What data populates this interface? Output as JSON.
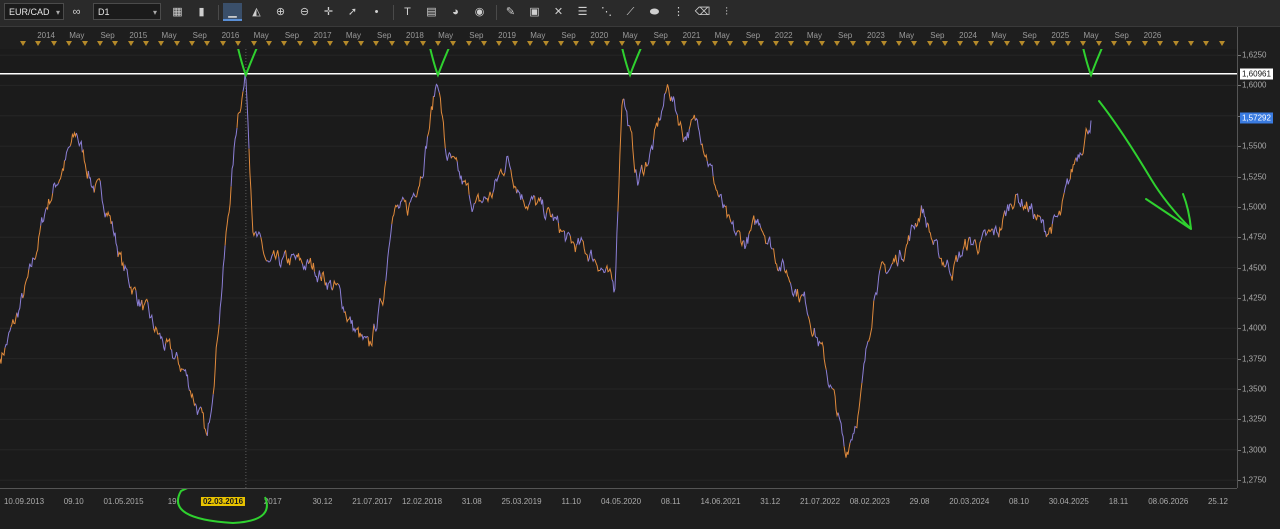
{
  "toolbar": {
    "symbol": "EUR/CAD",
    "timeframe": "D1",
    "buttons": [
      {
        "name": "chart-type-icon",
        "glyph": "▦"
      },
      {
        "name": "candle-icon",
        "glyph": "▮"
      },
      {
        "name": "line-chart-icon",
        "glyph": "▁",
        "active": true
      },
      {
        "name": "area-chart-icon",
        "glyph": "◭"
      },
      {
        "name": "zoom-in-icon",
        "glyph": "⊕"
      },
      {
        "name": "zoom-out-icon",
        "glyph": "⊖"
      },
      {
        "name": "crosshair-icon",
        "glyph": "✛"
      },
      {
        "name": "cursor-icon",
        "glyph": "➚"
      },
      {
        "name": "dot-icon",
        "glyph": "•"
      },
      {
        "name": "text-tool-icon",
        "glyph": "T"
      },
      {
        "name": "note-icon",
        "glyph": "▤"
      },
      {
        "name": "object-icon",
        "glyph": "◕"
      },
      {
        "name": "globe-icon",
        "glyph": "◉"
      },
      {
        "name": "pencil-icon",
        "glyph": "✎"
      },
      {
        "name": "template-icon",
        "glyph": "▣"
      },
      {
        "name": "pattern-icon",
        "glyph": "✕"
      },
      {
        "name": "channel-icon",
        "glyph": "☰"
      },
      {
        "name": "fibonacci-icon",
        "glyph": "⋱"
      },
      {
        "name": "trendline-icon",
        "glyph": "⟋"
      },
      {
        "name": "ellipse-icon",
        "glyph": "⬬"
      },
      {
        "name": "grid-icon",
        "glyph": "⋮"
      },
      {
        "name": "eraser-icon",
        "glyph": "⌫"
      },
      {
        "name": "indicators-icon",
        "glyph": "⫶"
      }
    ]
  },
  "chart_data": {
    "type": "line",
    "title": "",
    "xlabel": "",
    "ylabel": "",
    "ylim": [
      1.2685,
      1.63
    ],
    "x_range": [
      "2013-07",
      "2026-12"
    ],
    "y_ticks": [
      "1,6250",
      "1,6000",
      "1,5750",
      "1,5500",
      "1,5250",
      "1,5000",
      "1,4750",
      "1,4500",
      "1,4250",
      "1,4000",
      "1,3750",
      "1,3500",
      "1,3250",
      "1,3000",
      "1,2750"
    ],
    "price_labels": [
      {
        "value": "1,60961",
        "kind": "horizontal-line"
      },
      {
        "value": "1,57292",
        "kind": "current-price"
      }
    ],
    "top_labels": [
      "2014",
      "May",
      "Sep",
      "2015",
      "May",
      "Sep",
      "2016",
      "May",
      "Sep",
      "2017",
      "May",
      "Sep",
      "2018",
      "May",
      "Sep",
      "2019",
      "May",
      "Sep",
      "2020",
      "May",
      "Sep",
      "2021",
      "May",
      "Sep",
      "2022",
      "May",
      "Sep",
      "2023",
      "May",
      "Sep",
      "2024",
      "May",
      "Sep",
      "2025",
      "May",
      "Sep",
      "2026"
    ],
    "bottom_labels": [
      "10.09.2013",
      "09.10",
      "01.05.2015",
      "19.",
      "02.03.2016",
      "2017",
      "30.12",
      "21.07.2017",
      "12.02.2018",
      "31.08",
      "25.03.2019",
      "11.10",
      "04.05.2020",
      "08.11",
      "14.06.2021",
      "31.12",
      "21.07.2022",
      "08.02.2023",
      "29.08",
      "20.03.2024",
      "08.10",
      "30.04.2025",
      "18.11",
      "08.06.2026",
      "25.12"
    ],
    "highlighted_date": "02.03.2016",
    "series": [
      {
        "points": [
          [
            "2013-07",
            1.375
          ],
          [
            "2013-09",
            1.405
          ],
          [
            "2013-11",
            1.445
          ],
          [
            "2014-01",
            1.5
          ],
          [
            "2014-03",
            1.53
          ],
          [
            "2014-05",
            1.56
          ],
          [
            "2014-07",
            1.52
          ],
          [
            "2014-09",
            1.5
          ],
          [
            "2014-11",
            1.45
          ],
          [
            "2015-01",
            1.425
          ],
          [
            "2015-03",
            1.4
          ],
          [
            "2015-05",
            1.38
          ],
          [
            "2015-07",
            1.365
          ],
          [
            "2015-09",
            1.33
          ],
          [
            "2015-10",
            1.305
          ],
          [
            "2015-12",
            1.445
          ],
          [
            "2016-02",
            1.58
          ],
          [
            "2016-03",
            1.608
          ],
          [
            "2016-04",
            1.48
          ],
          [
            "2016-06",
            1.45
          ],
          [
            "2016-09",
            1.455
          ],
          [
            "2016-12",
            1.45
          ],
          [
            "2017-03",
            1.43
          ],
          [
            "2017-05",
            1.4
          ],
          [
            "2017-07",
            1.38
          ],
          [
            "2017-09",
            1.43
          ],
          [
            "2017-10",
            1.5
          ],
          [
            "2017-12",
            1.495
          ],
          [
            "2018-02",
            1.535
          ],
          [
            "2018-04",
            1.608
          ],
          [
            "2018-05",
            1.545
          ],
          [
            "2018-07",
            1.52
          ],
          [
            "2018-09",
            1.5
          ],
          [
            "2018-11",
            1.51
          ],
          [
            "2019-01",
            1.54
          ],
          [
            "2019-03",
            1.51
          ],
          [
            "2019-05",
            1.5
          ],
          [
            "2019-07",
            1.49
          ],
          [
            "2019-09",
            1.47
          ],
          [
            "2019-11",
            1.465
          ],
          [
            "2020-01",
            1.455
          ],
          [
            "2020-03",
            1.43
          ],
          [
            "2020-04",
            1.6
          ],
          [
            "2020-06",
            1.52
          ],
          [
            "2020-08",
            1.55
          ],
          [
            "2020-10",
            1.6
          ],
          [
            "2020-12",
            1.56
          ],
          [
            "2021-02",
            1.57
          ],
          [
            "2021-04",
            1.52
          ],
          [
            "2021-06",
            1.48
          ],
          [
            "2021-08",
            1.47
          ],
          [
            "2021-10",
            1.49
          ],
          [
            "2021-12",
            1.46
          ],
          [
            "2022-02",
            1.44
          ],
          [
            "2022-04",
            1.42
          ],
          [
            "2022-06",
            1.38
          ],
          [
            "2022-08",
            1.33
          ],
          [
            "2022-09",
            1.295
          ],
          [
            "2022-11",
            1.34
          ],
          [
            "2023-01",
            1.44
          ],
          [
            "2023-03",
            1.45
          ],
          [
            "2023-05",
            1.47
          ],
          [
            "2023-07",
            1.5
          ],
          [
            "2023-09",
            1.46
          ],
          [
            "2023-11",
            1.45
          ],
          [
            "2024-01",
            1.47
          ],
          [
            "2024-03",
            1.47
          ],
          [
            "2024-05",
            1.48
          ],
          [
            "2024-07",
            1.51
          ],
          [
            "2024-09",
            1.5
          ],
          [
            "2024-11",
            1.48
          ],
          [
            "2025-01",
            1.49
          ],
          [
            "2025-03",
            1.54
          ],
          [
            "2025-05",
            1.573
          ]
        ]
      }
    ]
  },
  "annotations": {
    "horizontal_level": 1.60961,
    "arrow_marks_at": [
      "2016-03",
      "2018-04",
      "2020-05",
      "2025-05"
    ]
  }
}
